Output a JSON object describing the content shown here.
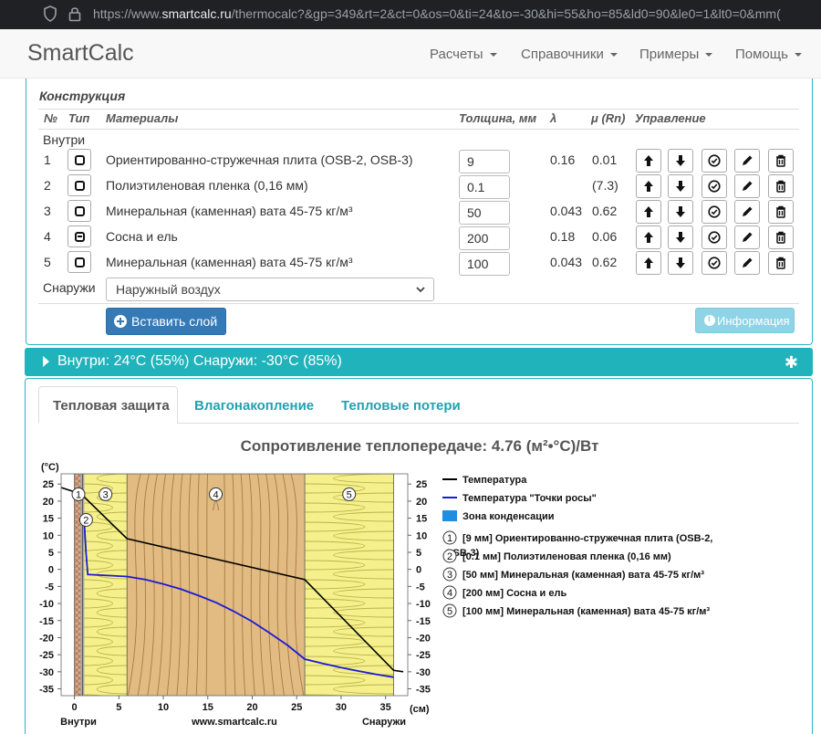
{
  "browser": {
    "url_prefix": "https://www.",
    "url_domain": "smartcalc.ru",
    "url_rest": "/thermocalc?&gp=349&rt=2&ct=0&os=0&ti=24&to=-30&hi=55&ho=85&ld0=90&le0=1&lt0=0&mm("
  },
  "nav": {
    "brand": "SmartCalc",
    "items": [
      "Расчеты",
      "Справочники",
      "Примеры",
      "Помощь"
    ]
  },
  "construction": {
    "title": "Конструкция",
    "headers": [
      "№",
      "Тип",
      "Материалы",
      "Толщина, мм",
      "λ",
      "μ (Rn)",
      "Управление"
    ],
    "inside_label": "Внутри",
    "outside_label": "Снаружи",
    "outside_select": "Наружный воздух",
    "layers": [
      {
        "n": "1",
        "material": "Ориентированно-стружечная плита (OSB-2, OSB-3)",
        "thickness": "9",
        "lambda": "0.16",
        "mu": "0.01",
        "type": "t1"
      },
      {
        "n": "2",
        "material": "Полиэтиленовая пленка (0,16 мм)",
        "thickness": "0.1",
        "lambda": "",
        "mu": "(7.3)",
        "type": "t1"
      },
      {
        "n": "3",
        "material": "Минеральная (каменная) вата 45-75 кг/м³",
        "thickness": "50",
        "lambda": "0.043",
        "mu": "0.62",
        "type": "t1"
      },
      {
        "n": "4",
        "material": "Сосна и ель",
        "thickness": "200",
        "lambda": "0.18",
        "mu": "0.06",
        "type": "t2"
      },
      {
        "n": "5",
        "material": "Минеральная (каменная) вата 45-75 кг/м³",
        "thickness": "100",
        "lambda": "0.043",
        "mu": "0.62",
        "type": "t1"
      }
    ],
    "insert_button": "Вставить слой",
    "info_button": "Информация"
  },
  "conditions": {
    "text": "Внутри: 24°C (55%) Снаружи: -30°C (85%)"
  },
  "tabs": [
    "Тепловая защита",
    "Влагонакопление",
    "Тепловые потери"
  ],
  "result": {
    "title": "Сопротивление теплопередаче: 4.76 (м²•°С)/Вт"
  },
  "chart_data": {
    "type": "line",
    "title": "",
    "ylabel": "(°C)",
    "xlabel": "(см)",
    "x_left_label": "Внутри",
    "x_center_label": "www.smartcalc.ru",
    "x_right_label": "Снаружи",
    "xlim": [
      -1.5,
      37.5
    ],
    "ylim": [
      -37,
      28
    ],
    "xticks": [
      0,
      5,
      10,
      15,
      20,
      25,
      30,
      35
    ],
    "yticks": [
      25,
      20,
      15,
      10,
      5,
      0,
      -5,
      -10,
      -15,
      -20,
      -25,
      -30,
      -35
    ],
    "layers": [
      {
        "label": "1",
        "from": 0,
        "to": 0.9
      },
      {
        "label": "2",
        "from": 0.9,
        "to": 0.91
      },
      {
        "label": "3",
        "from": 0.91,
        "to": 5.91
      },
      {
        "label": "4",
        "from": 5.91,
        "to": 25.91
      },
      {
        "label": "5",
        "from": 25.91,
        "to": 35.91
      }
    ],
    "series": [
      {
        "name": "Температура",
        "color": "#000000",
        "x": [
          -1.5,
          0,
          0.9,
          0.91,
          5.91,
          25.91,
          35.91,
          37
        ],
        "y": [
          24,
          22.7,
          21.8,
          21.7,
          9.0,
          -3.0,
          -29.6,
          -30
        ]
      },
      {
        "name": "Температура \"Точки росы\"",
        "color": "#1a1ad6",
        "x": [
          0.9,
          1.1,
          1.3,
          1.5,
          3,
          5.91,
          8,
          10,
          12,
          14,
          16,
          18,
          20,
          22,
          24,
          25.91,
          28,
          30,
          32,
          34,
          35.91
        ],
        "y": [
          14.6,
          14,
          5,
          -1.5,
          -1.7,
          -2.1,
          -3.0,
          -4.3,
          -5.8,
          -7.7,
          -9.8,
          -12.4,
          -15.3,
          -18.7,
          -22.3,
          -26.3,
          -27.6,
          -28.8,
          -29.8,
          -30.8,
          -31.6
        ]
      }
    ],
    "legend": [
      {
        "kind": "line",
        "color": "#000000",
        "label": "Температура"
      },
      {
        "kind": "line",
        "color": "#1a1ad6",
        "label": "Температура \"Точки росы\""
      },
      {
        "kind": "box",
        "color": "#1e8ee0",
        "label": "Зона конденсации"
      },
      {
        "kind": "num",
        "n": "1",
        "label": "[9 мм] Ориентированно-стружечная плита (OSB-2,",
        "label2": "OSB-3)"
      },
      {
        "kind": "num",
        "n": "2",
        "label": "[0.1 мм] Полиэтиленовая пленка (0,16 мм)"
      },
      {
        "kind": "num",
        "n": "3",
        "label": "[50 мм] Минеральная (каменная) вата 45-75 кг/м³"
      },
      {
        "kind": "num",
        "n": "4",
        "label": "[200 мм] Сосна и ель"
      },
      {
        "kind": "num",
        "n": "5",
        "label": "[100 мм] Минеральная (каменная) вата 45-75 кг/м³"
      }
    ]
  }
}
